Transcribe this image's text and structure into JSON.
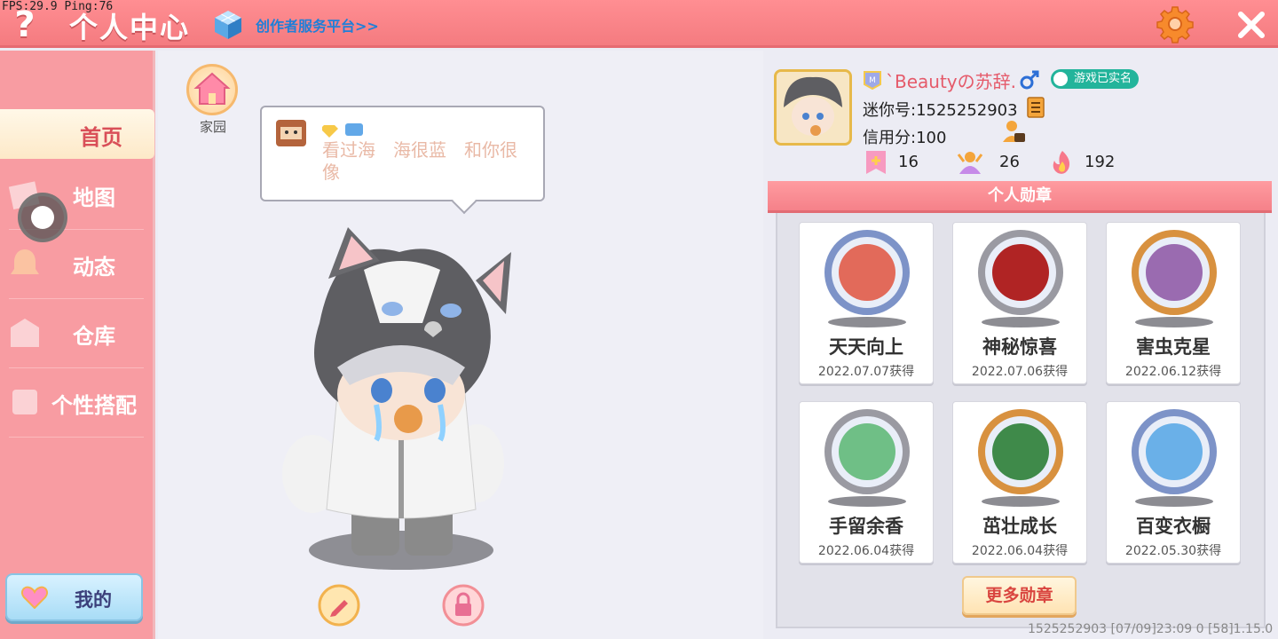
{
  "debug": {
    "text": "FPS:29.9  Ping:76"
  },
  "header": {
    "help_label": "?",
    "title": "个人中心",
    "creator_link": "创作者服务平台>>",
    "close_label": "✕"
  },
  "sidebar": {
    "items": [
      {
        "label": "首页",
        "active": true
      },
      {
        "label": "地图",
        "active": false
      },
      {
        "label": "动态",
        "active": false
      },
      {
        "label": "仓库",
        "active": false
      },
      {
        "label": "个性搭配",
        "active": false
      }
    ],
    "mine_label": "我的"
  },
  "stage": {
    "home_label": "家园",
    "signature": "看过海　海很蓝　和你很像"
  },
  "profile": {
    "username": "`Beautyの苏辞.",
    "verified": "游戏已实名",
    "id_line": "迷你号:1525252903",
    "credit_line": "信用分:100",
    "stats": [
      "16",
      "26",
      "192"
    ]
  },
  "medals": {
    "header": "个人勋章",
    "items": [
      {
        "name": "天天向上",
        "date": "2022.07.07获得",
        "ring": "#7d93c8",
        "face": "#e26a5a"
      },
      {
        "name": "神秘惊喜",
        "date": "2022.07.06获得",
        "ring": "#9a9aa2",
        "face": "#b02424"
      },
      {
        "name": "害虫克星",
        "date": "2022.06.12获得",
        "ring": "#d8913f",
        "face": "#9a6bb0"
      },
      {
        "name": "手留余香",
        "date": "2022.06.04获得",
        "ring": "#9a9aa2",
        "face": "#6fbf86"
      },
      {
        "name": "茁壮成长",
        "date": "2022.06.04获得",
        "ring": "#d8913f",
        "face": "#3f8a4a"
      },
      {
        "name": "百变衣橱",
        "date": "2022.05.30获得",
        "ring": "#7d93c8",
        "face": "#6ab0e8"
      }
    ],
    "more_label": "更多勋章"
  },
  "footer": {
    "text": "1525252903    [07/09]23:09 0  [58]1.15.0"
  },
  "colors": {
    "accent": "#f47b80",
    "title": "#ffffff",
    "link": "#1f7fd8"
  }
}
